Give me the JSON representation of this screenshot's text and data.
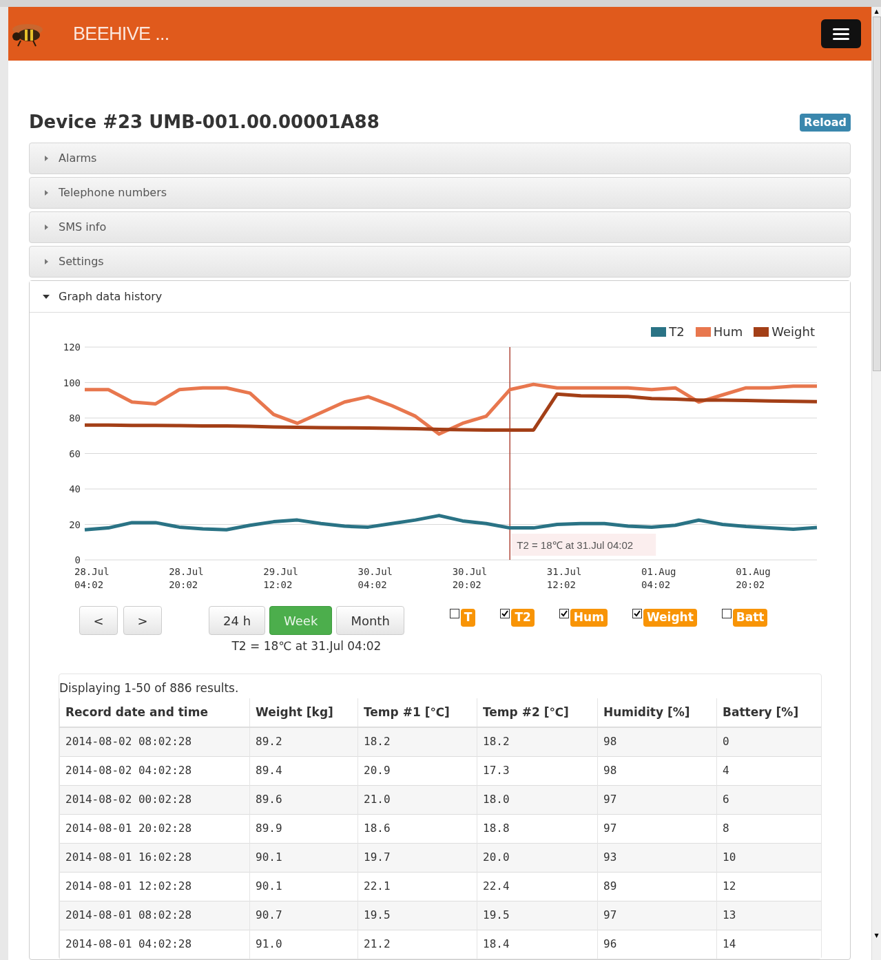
{
  "navbar": {
    "brand": "BEEHIVE ..."
  },
  "device": {
    "title": "Device #23 UMB-001.00.00001A88",
    "reload": "Reload"
  },
  "sections": [
    {
      "label": "Alarms",
      "expanded": false
    },
    {
      "label": "Telephone numbers",
      "expanded": false
    },
    {
      "label": "SMS info",
      "expanded": false
    },
    {
      "label": "Settings",
      "expanded": false
    },
    {
      "label": "Graph data history",
      "expanded": true
    }
  ],
  "graph": {
    "chart_data": {
      "type": "line",
      "categories": [
        "28.Jul 04:02",
        null,
        null,
        null,
        "28.Jul 20:02",
        null,
        null,
        null,
        "29.Jul 12:02",
        null,
        null,
        null,
        "30.Jul 04:02",
        null,
        null,
        null,
        "30.Jul 20:02",
        null,
        null,
        null,
        "31.Jul 12:02",
        null,
        null,
        null,
        "01.Aug 04:02",
        null,
        null,
        null,
        "01.Aug 20:02",
        null,
        null,
        null
      ],
      "grid": true,
      "legend": "top-right",
      "ylim": [
        0,
        120
      ],
      "yticks": [
        0,
        20,
        40,
        60,
        80,
        100,
        120
      ],
      "series": [
        {
          "name": "T2",
          "color": "#2a7385",
          "values": [
            17,
            18,
            21,
            21,
            18.5,
            17.5,
            17,
            19.5,
            21.5,
            22.5,
            20.5,
            19,
            18.5,
            20.5,
            22.5,
            25,
            22,
            20.5,
            18,
            18,
            20,
            20.5,
            20.5,
            19,
            18.4,
            19.5,
            22.4,
            20.0,
            18.8,
            18.0,
            17.3,
            18.2
          ]
        },
        {
          "name": "Hum",
          "color": "#e8774e",
          "values": [
            96,
            96,
            89,
            88,
            96,
            97,
            97,
            94,
            82,
            77,
            83,
            89,
            92,
            87,
            81,
            71,
            77,
            81,
            96,
            99,
            97,
            97,
            97,
            97,
            96,
            97,
            89,
            93,
            97,
            97,
            98,
            98
          ]
        },
        {
          "name": "Weight",
          "color": "#a33f17",
          "values": [
            76,
            76,
            75.8,
            75.8,
            75.7,
            75.5,
            75.5,
            75.3,
            75,
            74.8,
            74.6,
            74.5,
            74.4,
            74.2,
            74,
            73.6,
            73.4,
            73.2,
            73.2,
            73.2,
            93.5,
            92.5,
            92.3,
            92.1,
            91.0,
            90.7,
            90.1,
            90.1,
            89.9,
            89.6,
            89.4,
            89.2
          ]
        }
      ],
      "annotations": [
        "T2 = 18℃ at 31.Jul 04:02"
      ]
    },
    "nav_buttons": [
      "<",
      ">"
    ],
    "ranges": [
      {
        "label": "24 h",
        "selected": false
      },
      {
        "label": "Week",
        "selected": true
      },
      {
        "label": "Month",
        "selected": false
      }
    ],
    "toggles": [
      {
        "label": "T",
        "checked": false
      },
      {
        "label": "T2",
        "checked": true
      },
      {
        "label": "Hum",
        "checked": true
      },
      {
        "label": "Weight",
        "checked": true
      },
      {
        "label": "Batt",
        "checked": false
      }
    ],
    "readout": "T2 = 18℃ at 31.Jul 04:02"
  },
  "scrollbar": {
    "up": "▲",
    "down": "▼"
  },
  "table": {
    "summary": "Displaying 1-50 of 886 results.",
    "columns": [
      "Record date and time",
      "Weight [kg]",
      "Temp #1 [℃]",
      "Temp #2 [℃]",
      "Humidity [%]",
      "Battery [%]"
    ],
    "rows": [
      [
        "2014-08-02 08:02:28",
        "89.2",
        "18.2",
        "18.2",
        "98",
        "0"
      ],
      [
        "2014-08-02 04:02:28",
        "89.4",
        "20.9",
        "17.3",
        "98",
        "4"
      ],
      [
        "2014-08-02 00:02:28",
        "89.6",
        "21.0",
        "18.0",
        "97",
        "6"
      ],
      [
        "2014-08-01 20:02:28",
        "89.9",
        "18.6",
        "18.8",
        "97",
        "8"
      ],
      [
        "2014-08-01 16:02:28",
        "90.1",
        "19.7",
        "20.0",
        "93",
        "10"
      ],
      [
        "2014-08-01 12:02:28",
        "90.1",
        "22.1",
        "22.4",
        "89",
        "12"
      ],
      [
        "2014-08-01 08:02:28",
        "90.7",
        "19.5",
        "19.5",
        "97",
        "13"
      ],
      [
        "2014-08-01 04:02:28",
        "91.0",
        "21.2",
        "18.4",
        "96",
        "14"
      ]
    ]
  }
}
